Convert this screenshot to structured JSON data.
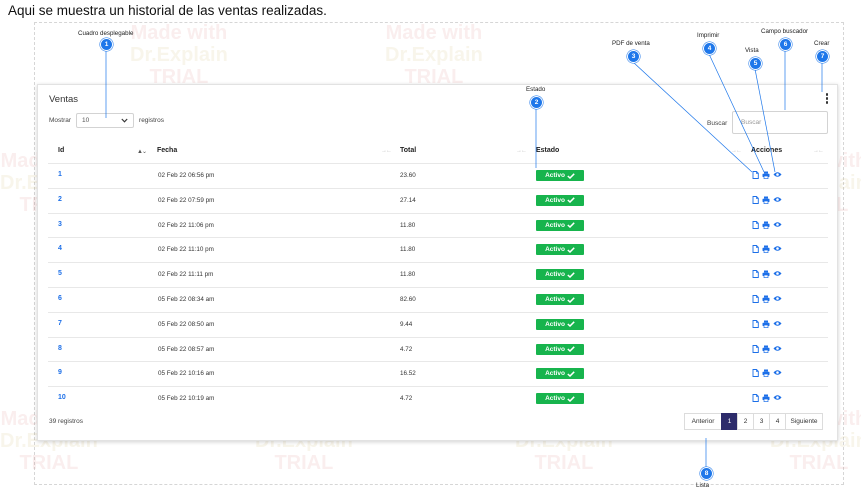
{
  "page_heading": "Aqui se muestra un historial de las ventas realizadas.",
  "watermark": {
    "line1": "Made with",
    "line2": "Dr.Explain",
    "line3": "TRIAL"
  },
  "card": {
    "title": "Ventas",
    "show_label": "Mostrar",
    "entries_value": "10",
    "entries_suffix": "registros",
    "search_label": "Buscar",
    "search_placeholder": "Buscar"
  },
  "table": {
    "headers": {
      "id": "Id",
      "fecha": "Fecha",
      "total": "Total",
      "estado": "Estado",
      "acciones": "Acciones"
    },
    "rows": [
      {
        "id": "1",
        "fecha": "02 Feb 22 06:56 pm",
        "total": "23.60",
        "estado": "Activo"
      },
      {
        "id": "2",
        "fecha": "02 Feb 22 07:59 pm",
        "total": "27.14",
        "estado": "Activo"
      },
      {
        "id": "3",
        "fecha": "02 Feb 22 11:06 pm",
        "total": "11.80",
        "estado": "Activo"
      },
      {
        "id": "4",
        "fecha": "02 Feb 22 11:10 pm",
        "total": "11.80",
        "estado": "Activo"
      },
      {
        "id": "5",
        "fecha": "02 Feb 22 11:11 pm",
        "total": "11.80",
        "estado": "Activo"
      },
      {
        "id": "6",
        "fecha": "05 Feb 22 08:34 am",
        "total": "82.60",
        "estado": "Activo"
      },
      {
        "id": "7",
        "fecha": "05 Feb 22 08:50 am",
        "total": "9.44",
        "estado": "Activo"
      },
      {
        "id": "8",
        "fecha": "05 Feb 22 08:57 am",
        "total": "4.72",
        "estado": "Activo"
      },
      {
        "id": "9",
        "fecha": "05 Feb 22 10:16 am",
        "total": "16.52",
        "estado": "Activo"
      },
      {
        "id": "10",
        "fecha": "05 Feb 22 10:19 am",
        "total": "4.72",
        "estado": "Activo"
      }
    ]
  },
  "footer": {
    "record_count": "39 registros",
    "prev": "Anterior",
    "pages": [
      "1",
      "2",
      "3",
      "4"
    ],
    "active_page": "1",
    "next": "Siguiente"
  },
  "callouts": [
    {
      "num": "1",
      "label": "Cuadro desplegable"
    },
    {
      "num": "2",
      "label": "Estado"
    },
    {
      "num": "3",
      "label": "PDF de venta"
    },
    {
      "num": "4",
      "label": "Imprimir"
    },
    {
      "num": "5",
      "label": "Vista"
    },
    {
      "num": "6",
      "label": "Campo buscador"
    },
    {
      "num": "7",
      "label": "Crear"
    },
    {
      "num": "8",
      "label": "Lista"
    }
  ],
  "colors": {
    "link_blue": "#1c6fe8",
    "badge_green": "#17b44d",
    "pagination_active": "#2d2c6b",
    "callout_blue": "#1e77ea"
  },
  "icons": [
    "chevron-down-icon",
    "sort-icon",
    "check-icon",
    "pdf-file-icon",
    "print-icon",
    "eye-icon",
    "kebab-menu-icon"
  ]
}
